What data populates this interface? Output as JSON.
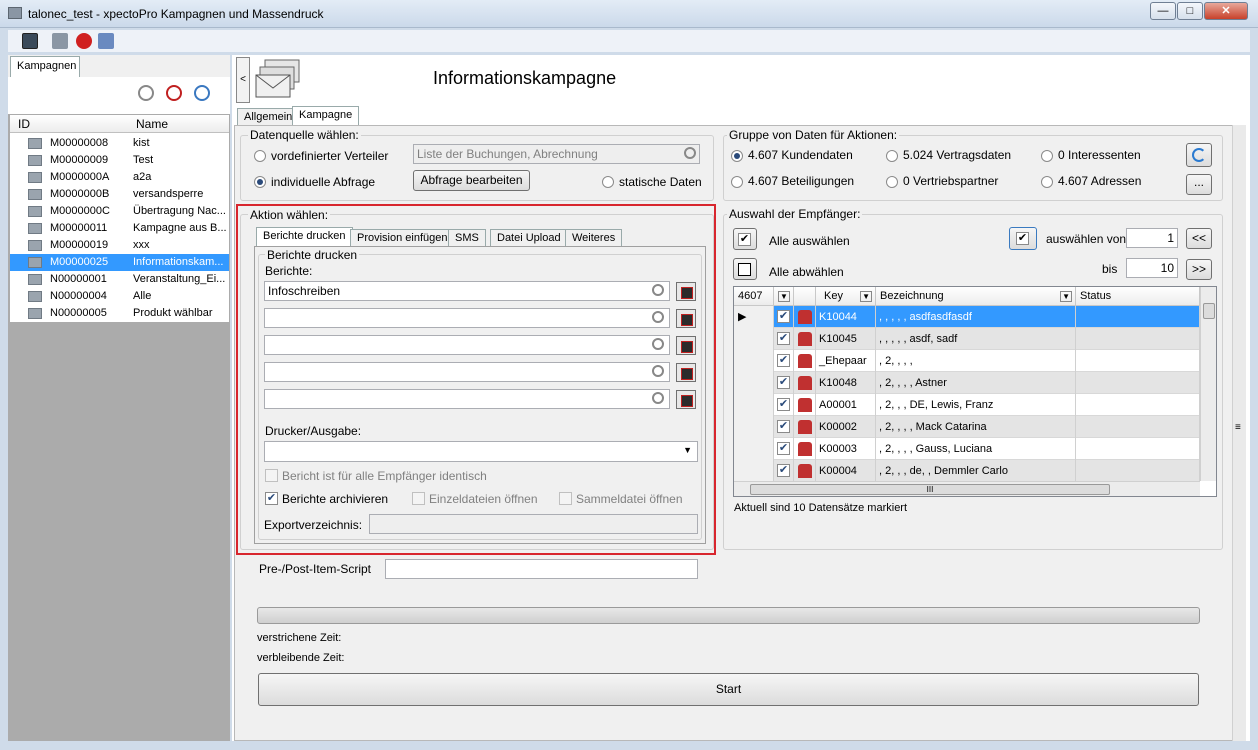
{
  "window": {
    "title": "talonec_test - xpectoPro Kampagnen und Massendruck",
    "minimize": "—",
    "maximize": "□",
    "close": "✕"
  },
  "left_panel": {
    "tab": "Kampagnen",
    "col_id": "ID",
    "col_name": "Name",
    "rows": [
      {
        "id": "M00000008",
        "name": "kist"
      },
      {
        "id": "M00000009",
        "name": "Test"
      },
      {
        "id": "M0000000A",
        "name": "a2a"
      },
      {
        "id": "M0000000B",
        "name": "versandsperre"
      },
      {
        "id": "M0000000C",
        "name": "Übertragung Nac..."
      },
      {
        "id": "M00000011",
        "name": "Kampagne aus B..."
      },
      {
        "id": "M00000019",
        "name": "xxx"
      },
      {
        "id": "M00000025",
        "name": "Informationskam..."
      },
      {
        "id": "N00000001",
        "name": "Veranstaltung_Ei..."
      },
      {
        "id": "N00000004",
        "name": "Alle"
      },
      {
        "id": "N00000005",
        "name": "Produkt wählbar"
      }
    ]
  },
  "header": {
    "collapse": "<",
    "title": "Informationskampagne"
  },
  "tabs": [
    "Allgemein",
    "Kampagne"
  ],
  "datenquelle": {
    "label": "Datenquelle wählen:",
    "opt1": "vordefinierter Verteiler",
    "opt2": "individuelle Abfrage",
    "opt3": "statische Daten",
    "dropdown_value": "Liste der Buchungen, Abrechnung",
    "edit_button": "Abfrage bearbeiten"
  },
  "gruppe": {
    "label": "Gruppe von Daten für Aktionen:",
    "items": [
      "4.607 Kundendaten",
      "5.024 Vertragsdaten",
      "0 Interessenten",
      "4.607 Beteiligungen",
      "0 Vertriebspartner",
      "4.607 Adressen"
    ],
    "more_button": "..."
  },
  "aktion": {
    "label": "Aktion wählen:",
    "tabs": [
      "Berichte drucken",
      "Provision einfügen",
      "SMS",
      "Datei Upload",
      "Weiteres"
    ],
    "group_label": "Berichte drucken",
    "berichte_label": "Berichte:",
    "berichte": [
      "Infoschreiben",
      "",
      "",
      "",
      ""
    ],
    "drucker_label": "Drucker/Ausgabe:",
    "drucker_value": "",
    "cb_identisch": "Bericht ist für alle Empfänger identisch",
    "cb_archivieren": "Berichte archivieren",
    "cb_einzel": "Einzeldateien öffnen",
    "cb_sammel": "Sammeldatei öffnen",
    "export_label": "Exportverzeichnis:",
    "export_value": ""
  },
  "script": {
    "label": "Pre-/Post-Item-Script",
    "value": ""
  },
  "empfaenger": {
    "label": "Auswahl der Empfänger:",
    "alle_auswaehlen": "Alle auswählen",
    "alle_abwaehlen": "Alle abwählen",
    "auswaehlen_von": "auswählen von",
    "von_value": "1",
    "bis": "bis",
    "bis_value": "10",
    "prev": "<<",
    "next": ">>",
    "grid": {
      "count": "4607",
      "col_key": "Key",
      "col_bez": "Bezeichnung",
      "col_status": "Status",
      "rows": [
        {
          "key": "K10044",
          "bez": ", , , , , asdfasdfasdf",
          "status": ""
        },
        {
          "key": "K10045",
          "bez": ", , , , , asdf, sadf",
          "status": ""
        },
        {
          "key": "_Ehepaar",
          "bez": ", 2, , , ,",
          "status": ""
        },
        {
          "key": "K10048",
          "bez": ", 2, , , , Astner",
          "status": ""
        },
        {
          "key": "A00001",
          "bez": ", 2, , , DE, Lewis, Franz",
          "status": ""
        },
        {
          "key": "K00002",
          "bez": ", 2, , , , Mack Catarina",
          "status": ""
        },
        {
          "key": "K00003",
          "bez": ", 2, , , , Gauss, Luciana",
          "status": ""
        },
        {
          "key": "K00004",
          "bez": ", 2, , , de, , Demmler Carlo",
          "status": ""
        }
      ],
      "hscroll": "III"
    },
    "status": "Aktuell sind 10 Datensätze markiert"
  },
  "time": {
    "verstrichen": "verstrichene Zeit:",
    "verbleibend": "verbleibende Zeit:"
  },
  "start_button": "Start"
}
